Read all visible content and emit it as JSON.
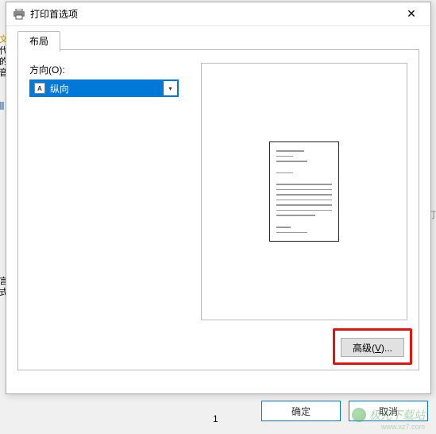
{
  "dialog": {
    "title": "打印首选项",
    "close_glyph": "✕"
  },
  "tabs": {
    "layout": "布局"
  },
  "orientation": {
    "label": "方向(O):",
    "value": "纵向",
    "icon_letter": "A",
    "arrow": "▾"
  },
  "buttons": {
    "advanced": "高级(V)...",
    "ok": "确定",
    "cancel": "取消"
  },
  "background": {
    "left_chars": [
      "文",
      "代",
      "的",
      "音",
      "形",
      "言",
      "式"
    ],
    "page_number": "1",
    "right_mark": "订"
  },
  "watermark": {
    "text": "极光下载站",
    "url": "www.xz7.com"
  }
}
